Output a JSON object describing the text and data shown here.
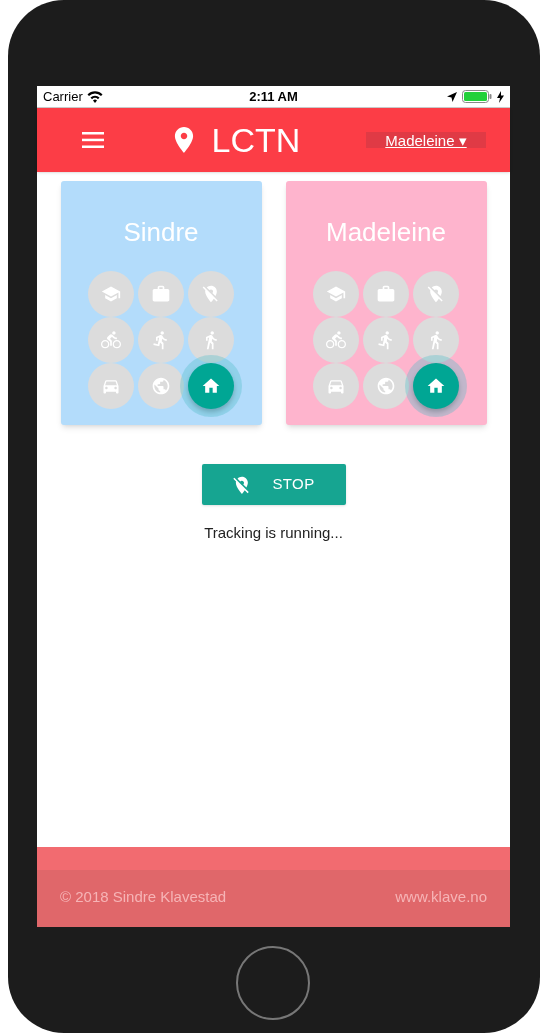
{
  "status_bar": {
    "carrier": "Carrier",
    "time": "2:11 AM"
  },
  "header": {
    "title": "LCTN",
    "user_menu": "Madeleine ▾"
  },
  "people": [
    {
      "name": "Sindre",
      "color": "#b3dcfb",
      "places": [
        {
          "kind": "school",
          "selected": false
        },
        {
          "kind": "work",
          "selected": false
        },
        {
          "kind": "location-off",
          "selected": false
        },
        {
          "kind": "bike",
          "selected": false
        },
        {
          "kind": "run",
          "selected": false
        },
        {
          "kind": "walk",
          "selected": false
        },
        {
          "kind": "car",
          "selected": false
        },
        {
          "kind": "globe",
          "selected": false
        },
        {
          "kind": "home",
          "selected": true
        }
      ]
    },
    {
      "name": "Madeleine",
      "color": "#feb4cd",
      "places": [
        {
          "kind": "school",
          "selected": false
        },
        {
          "kind": "work",
          "selected": false
        },
        {
          "kind": "location-off",
          "selected": false
        },
        {
          "kind": "bike",
          "selected": false
        },
        {
          "kind": "run",
          "selected": false
        },
        {
          "kind": "walk",
          "selected": false
        },
        {
          "kind": "car",
          "selected": false
        },
        {
          "kind": "globe",
          "selected": false
        },
        {
          "kind": "home",
          "selected": true
        }
      ]
    }
  ],
  "stop_button": {
    "label": "STOP"
  },
  "status_text": "Tracking is running...",
  "footer": {
    "copyright": "© 2018 Sindre Klavestad",
    "link": "www.klave.no"
  }
}
